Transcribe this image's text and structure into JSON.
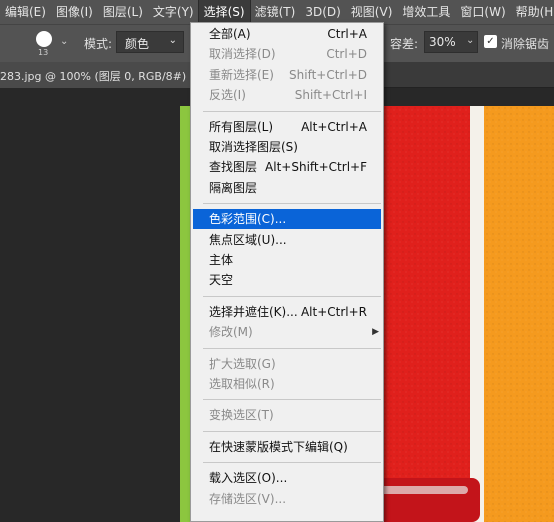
{
  "menubar": {
    "items": [
      {
        "label": "编辑(E)"
      },
      {
        "label": "图像(I)"
      },
      {
        "label": "图层(L)"
      },
      {
        "label": "文字(Y)"
      },
      {
        "label": "选择(S)"
      },
      {
        "label": "滤镜(T)"
      },
      {
        "label": "3D(D)"
      },
      {
        "label": "视图(V)"
      },
      {
        "label": "增效工具"
      },
      {
        "label": "窗口(W)"
      },
      {
        "label": "帮助(H)"
      }
    ],
    "active_index": 4
  },
  "options": {
    "brush_size": "13",
    "mode_label": "模式:",
    "mode_value": "颜色",
    "tolerance_label": "容差:",
    "tolerance_value": "30%",
    "antialias_label": "消除锯齿",
    "antialias_checked": true
  },
  "document_tab": {
    "title": "283.jpg @ 100% (图层 0, RGB/8#) *"
  },
  "select_menu": {
    "groups": [
      [
        {
          "label": "全部(A)",
          "shortcut": "Ctrl+A",
          "disabled": false
        },
        {
          "label": "取消选择(D)",
          "shortcut": "Ctrl+D",
          "disabled": true
        },
        {
          "label": "重新选择(E)",
          "shortcut": "Shift+Ctrl+D",
          "disabled": true
        },
        {
          "label": "反选(I)",
          "shortcut": "Shift+Ctrl+I",
          "disabled": true
        }
      ],
      [
        {
          "label": "所有图层(L)",
          "shortcut": "Alt+Ctrl+A",
          "disabled": false
        },
        {
          "label": "取消选择图层(S)",
          "shortcut": "",
          "disabled": false
        },
        {
          "label": "查找图层",
          "shortcut": "Alt+Shift+Ctrl+F",
          "disabled": false
        },
        {
          "label": "隔离图层",
          "shortcut": "",
          "disabled": false
        }
      ],
      [
        {
          "label": "色彩范围(C)...",
          "shortcut": "",
          "disabled": false,
          "highlighted": true
        },
        {
          "label": "焦点区域(U)...",
          "shortcut": "",
          "disabled": false
        },
        {
          "label": "主体",
          "shortcut": "",
          "disabled": false
        },
        {
          "label": "天空",
          "shortcut": "",
          "disabled": false
        }
      ],
      [
        {
          "label": "选择并遮住(K)...",
          "shortcut": "Alt+Ctrl+R",
          "disabled": false
        },
        {
          "label": "修改(M)",
          "shortcut": "",
          "disabled": true,
          "submenu": true
        }
      ],
      [
        {
          "label": "扩大选取(G)",
          "shortcut": "",
          "disabled": true
        },
        {
          "label": "选取相似(R)",
          "shortcut": "",
          "disabled": true
        }
      ],
      [
        {
          "label": "变换选区(T)",
          "shortcut": "",
          "disabled": true
        }
      ],
      [
        {
          "label": "在快速蒙版模式下编辑(Q)",
          "shortcut": "",
          "disabled": false
        }
      ],
      [
        {
          "label": "载入选区(O)...",
          "shortcut": "",
          "disabled": false
        },
        {
          "label": "存储选区(V)...",
          "shortcut": "",
          "disabled": true
        }
      ]
    ]
  },
  "colors": {
    "menu_highlight": "#0a64d8",
    "photo_red": "#e0201c",
    "photo_orange": "#f59a1e",
    "photo_green": "#8cc63f"
  }
}
